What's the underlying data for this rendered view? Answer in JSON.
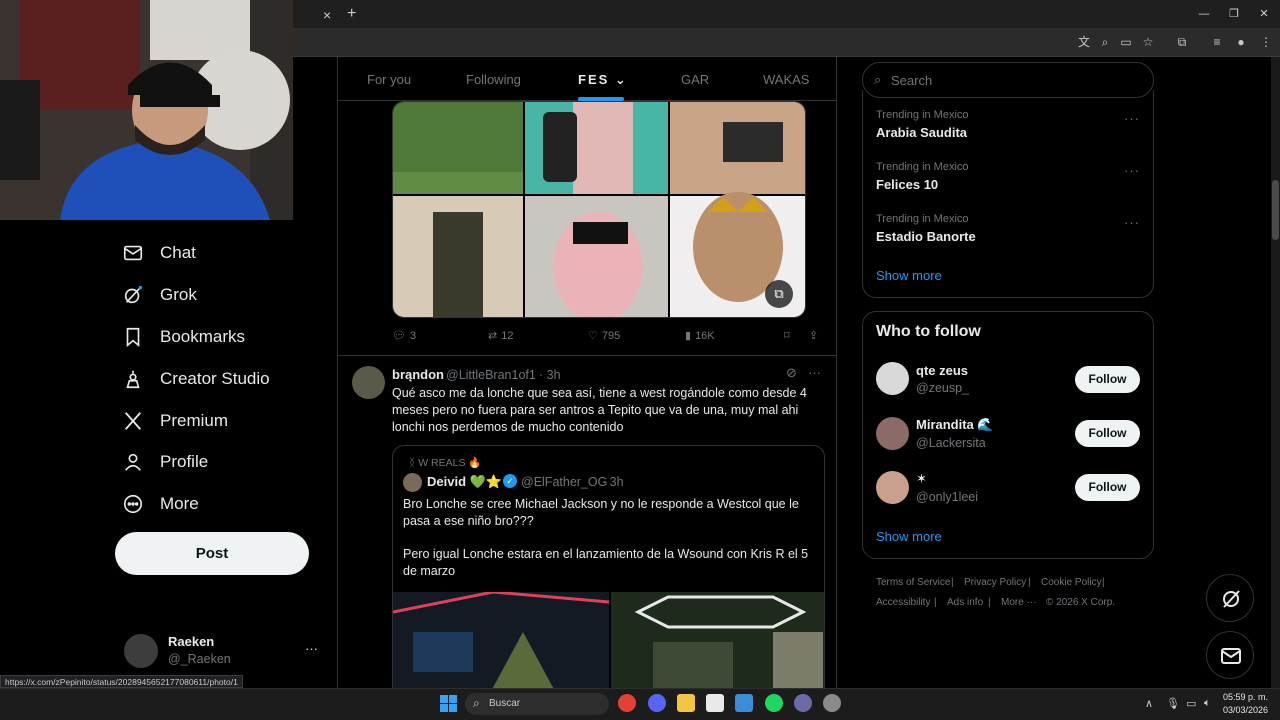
{
  "browser": {
    "new_tab_symbol": "+",
    "tab_close_symbol": "×",
    "status_url": "https://x.com/zPepinito/status/2028945652177080611/photo/1"
  },
  "sidebar": {
    "items": [
      {
        "label": "Chat",
        "icon": "mail-icon"
      },
      {
        "label": "Grok",
        "icon": "grok-icon"
      },
      {
        "label": "Bookmarks",
        "icon": "bookmark-icon"
      },
      {
        "label": "Creator Studio",
        "icon": "creator-studio-icon"
      },
      {
        "label": "Premium",
        "icon": "x-logo-icon"
      },
      {
        "label": "Profile",
        "icon": "person-icon"
      },
      {
        "label": "More",
        "icon": "more-circle-icon"
      }
    ],
    "post_label": "Post",
    "account": {
      "name": "Raeken",
      "handle": "@_Raeken",
      "menu": "···"
    }
  },
  "feed": {
    "tabs": [
      {
        "label": "For you"
      },
      {
        "label": "Following"
      },
      {
        "label": "FES"
      },
      {
        "label": "GAR"
      },
      {
        "label": "WAKAS"
      }
    ],
    "active_tab": "FES",
    "first_tweet_actions": {
      "replies": "3",
      "reposts": "12",
      "likes": "795",
      "views": "16K"
    },
    "tweet": {
      "name": "brąndon",
      "handle": "@LittleBran1of1",
      "time": "· 3h",
      "text": "Qué asco me da lonche que sea así, tiene a west rogándole como desde 4 meses pero no fuera para ser antros a Tepito que va de una, muy mal ahi lonchi nos perdemos de mucho contenido",
      "quote": {
        "context": "W REALS 🔥",
        "name": "Deivid 💚⭐",
        "handle": "@ElFather_OG",
        "time": "· 3h",
        "text1": "Bro Lonche se cree Michael Jackson y no le responde a Westcol que le pasa a ese niño bro???",
        "text2": "Pero igual Lonche estara en el lanzamiento de la Wsound con Kris R el 5 de marzo"
      }
    }
  },
  "right": {
    "search_placeholder": "Search",
    "trends": [
      {
        "category": "Trending in Mexico",
        "name": "Arabia Saudita"
      },
      {
        "category": "Trending in Mexico",
        "name": "Felices 10"
      },
      {
        "category": "Trending in Mexico",
        "name": "Estadio Banorte"
      }
    ],
    "trends_show_more": "Show more",
    "who_to_follow_title": "Who to follow",
    "who_to_follow": [
      {
        "name": "qte zeus",
        "handle": "@zeusp_",
        "button": "Follow"
      },
      {
        "name": "Mirandita 🌊",
        "handle": "@Lackersita",
        "button": "Follow"
      },
      {
        "name": "✶",
        "handle": "@only1leei",
        "button": "Follow"
      }
    ],
    "wtf_show_more": "Show more",
    "footer": [
      "Terms of Service",
      "|",
      "Privacy Policy",
      "|",
      "Cookie Policy",
      "|",
      "Accessibility",
      "|",
      "Ads info",
      "|",
      "More ···",
      "© 2026 X Corp."
    ]
  },
  "taskbar": {
    "search_label": "Buscar",
    "time": "05:59 p. m.",
    "date": "03/03/2026"
  },
  "colors": {
    "accent": "#1d9bf0",
    "background": "#000000",
    "border": "#2f3336",
    "muted": "#71767b"
  }
}
